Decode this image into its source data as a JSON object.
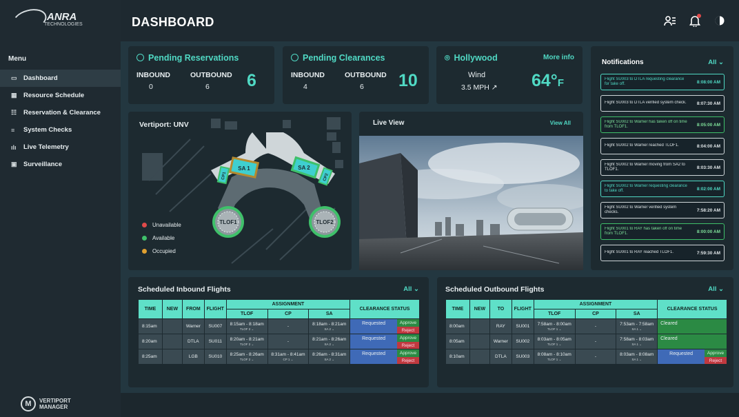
{
  "brand": {
    "name": "ANRA",
    "sub": "TECHNOLOGIES",
    "app_line1": "VERTIPORT",
    "app_line2": "MANAGER"
  },
  "header": {
    "title": "DASHBOARD"
  },
  "menu": {
    "title": "Menu",
    "items": [
      {
        "label": "Dashboard",
        "icon": "monitor-icon",
        "glyph": "▭"
      },
      {
        "label": "Resource Schedule",
        "icon": "calendar-grid-icon",
        "glyph": "▦"
      },
      {
        "label": "Reservation & Clearance",
        "icon": "checklist-icon",
        "glyph": "☷"
      },
      {
        "label": "System Checks",
        "icon": "sliders-icon",
        "glyph": "≡"
      },
      {
        "label": "Live Telemetry",
        "icon": "signal-icon",
        "glyph": "ılı"
      },
      {
        "label": "Surveillance",
        "icon": "video-icon",
        "glyph": "▣"
      }
    ]
  },
  "pending_reservations": {
    "title": "Pending Reservations",
    "inbound_label": "INBOUND",
    "outbound_label": "OUTBOUND",
    "inbound": "0",
    "outbound": "6",
    "total": "6"
  },
  "pending_clearances": {
    "title": "Pending Clearances",
    "inbound_label": "INBOUND",
    "outbound_label": "OUTBOUND",
    "inbound": "4",
    "outbound": "6",
    "total": "10"
  },
  "weather": {
    "location": "Hollywood",
    "more_info": "More info",
    "wind_label": "Wind",
    "wind_value": "3.5 MPH ↗",
    "temp": "64°",
    "temp_unit": "F"
  },
  "notifications": {
    "title": "Notifications",
    "filter": "All ⌄",
    "items": [
      {
        "text": "Flight SU003 to DTLA requesting clearance for take off.",
        "time": "8:08:00 AM",
        "style": "teal"
      },
      {
        "text": "Flight SU003 to DTLA verified system check.",
        "time": "8:07:30 AM",
        "style": "white"
      },
      {
        "text": "Flight SU002 to Warner has taken off on time from TLOF1.",
        "time": "8:05:00 AM",
        "style": "green"
      },
      {
        "text": "Flight SU002 to Warner reached TLOF1.",
        "time": "8:04:00 AM",
        "style": "white"
      },
      {
        "text": "Flight SU002 to Warner moving from SA2 to TLOF1.",
        "time": "8:03:30 AM",
        "style": "white"
      },
      {
        "text": "Flight SU002 to Warner requesting clearance to take off.",
        "time": "8:02:00 AM",
        "style": "teal"
      },
      {
        "text": "Flight SU002 to Warner verified system checks.",
        "time": "7:58:20 AM",
        "style": "white"
      },
      {
        "text": "Flight SU001 to RAY has taken off on time from TLOF1.",
        "time": "8:00:00 AM",
        "style": "green"
      },
      {
        "text": "Flight SU001 to RAY reached TLOF1.",
        "time": "7:59:30 AM",
        "style": "white"
      }
    ]
  },
  "vertiport": {
    "title": "Vertiport: UNV",
    "labels": {
      "sa1": "SA 1",
      "sa2": "SA 2",
      "cp1": "CP1",
      "cp2": "CP2",
      "tlof1": "TLOF1",
      "tlof2": "TLOF2"
    },
    "legend": [
      {
        "label": "Unavailable",
        "color": "#e04a4a"
      },
      {
        "label": "Available",
        "color": "#3fc06a"
      },
      {
        "label": "Occupied",
        "color": "#e0a030"
      }
    ]
  },
  "live_view": {
    "title": "Live View",
    "view_all": "View All"
  },
  "inbound": {
    "title": "Scheduled  Inbound Flights",
    "filter": "All ⌄",
    "headers": {
      "time": "TIME",
      "new": "NEW",
      "from": "FROM",
      "flight": "FLIGHT",
      "assignment": "ASSIGNMENT",
      "clearance": "CLEARANCE STATUS",
      "tlof": "TLOF",
      "cp": "CP",
      "sa": "SA"
    },
    "rows": [
      {
        "time": "8:15am",
        "from": "Warner",
        "flight": "SU007",
        "tlof": "8:15am - 8:18am",
        "tlof_sub": "TLOF 2",
        "cp": "-",
        "cp_sub": "",
        "sa": "8:18am - 8:21am",
        "sa_sub": "SA 2",
        "status": "Requested",
        "approve": "Approve",
        "reject": "Reject"
      },
      {
        "time": "8:20am",
        "from": "DTLA",
        "flight": "SU011",
        "tlof": "8:20am - 8:21am",
        "tlof_sub": "TLOF 2",
        "cp": "-",
        "cp_sub": "",
        "sa": "8:21am - 8:26am",
        "sa_sub": "SA 2",
        "status": "Requested",
        "approve": "Approve",
        "reject": "Reject"
      },
      {
        "time": "8:25am",
        "from": "LGB",
        "flight": "SU010",
        "tlof": "8:25am - 8:26am",
        "tlof_sub": "TLOF 2",
        "cp": "8:31am - 8:41am",
        "cp_sub": "CP 1",
        "sa": "8:26am - 8:31am",
        "sa_sub": "SA 2",
        "status": "Requested",
        "approve": "Approve",
        "reject": "Reject"
      }
    ]
  },
  "outbound": {
    "title": "Scheduled  Outbound Flights",
    "filter": "All ⌄",
    "headers": {
      "time": "TIME",
      "new": "NEW",
      "to": "TO",
      "flight": "FLIGHT",
      "assignment": "ASSIGNMENT",
      "clearance": "CLEARANCE STATUS",
      "tlof": "TLOF",
      "cp": "CP",
      "sa": "SA"
    },
    "rows": [
      {
        "time": "8:00am",
        "to": "RAY",
        "flight": "SU001",
        "tlof": "7:58am - 8:00am",
        "tlof_sub": "TLOF 1",
        "cp": "-",
        "sa": "7:53am - 7:58am",
        "sa_sub": "SA 1",
        "status": "Cleared"
      },
      {
        "time": "8:05am",
        "to": "Warner",
        "flight": "SU002",
        "tlof": "8:03am - 8:05am",
        "tlof_sub": "TLOF 1",
        "cp": "-",
        "sa": "7:58am - 8:03am",
        "sa_sub": "SA 1",
        "status": "Cleared"
      },
      {
        "time": "8:10am",
        "to": "DTLA",
        "flight": "SU003",
        "tlof": "8:08am - 8:10am",
        "tlof_sub": "TLOF 1",
        "cp": "-",
        "sa": "8:03am - 8:08am",
        "sa_sub": "SA 1",
        "status": "Requested",
        "approve": "Approve",
        "reject": "Reject"
      }
    ]
  },
  "colors": {
    "accent": "#50d9c4",
    "bg": "#233740",
    "card": "#1d2a30",
    "approve": "#2b8a44",
    "reject": "#c0393f",
    "requested": "#3f6ab7"
  }
}
